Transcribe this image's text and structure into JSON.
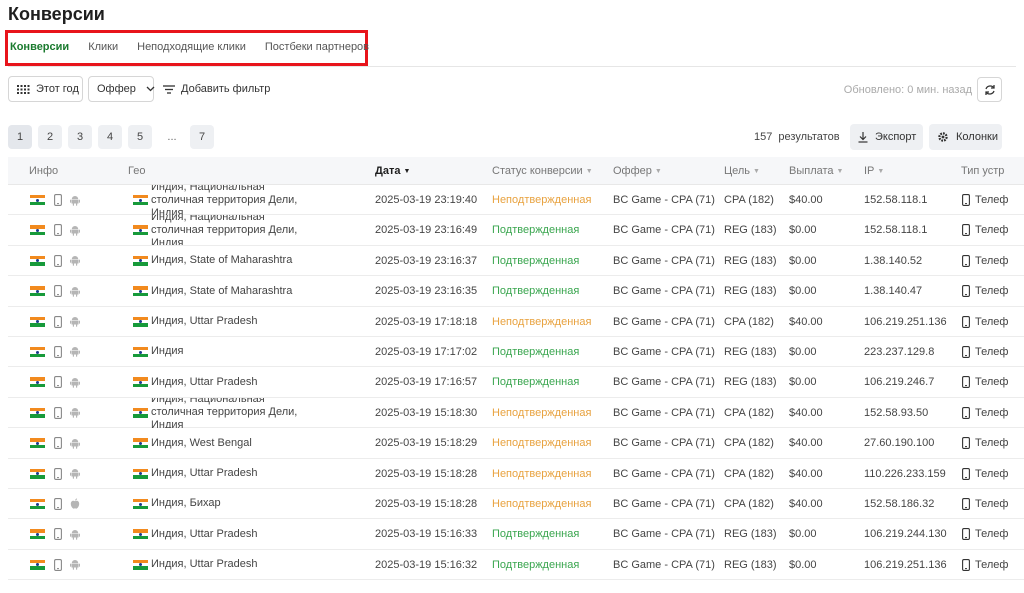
{
  "page": {
    "title": "Конверсии"
  },
  "tabs": [
    {
      "label": "Конверсии",
      "active": true
    },
    {
      "label": "Клики",
      "active": false
    },
    {
      "label": "Неподходящие клики",
      "active": false
    },
    {
      "label": "Постбеки партнеров",
      "active": false
    }
  ],
  "toolbar": {
    "period_label": "Этот год",
    "offer_label": "Оффер",
    "add_filter_label": "Добавить фильтр",
    "updated_text": "Обновлено: 0 мин. назад"
  },
  "pagination": {
    "pages": [
      "1",
      "2",
      "3",
      "4",
      "5"
    ],
    "dots": "...",
    "last_page": "7",
    "current": "1"
  },
  "results": {
    "count": "157",
    "label": "результатов",
    "export_label": "Экспорт",
    "columns_label": "Колонки"
  },
  "table": {
    "headers": {
      "info": "Инфо",
      "geo": "Гео",
      "date": "Дата",
      "status": "Статус конверсии",
      "offer": "Оффер",
      "goal": "Цель",
      "payout": "Выплата",
      "ip": "IP",
      "device": "Тип устр"
    },
    "rows": [
      {
        "geo": "Индия, Национальная столичная территория Дели, Индия",
        "date": "2025-03-19 23:19:40",
        "status": "Неподтвержденная",
        "status_kind": "pending",
        "offer": "BC Game - CPA (71)",
        "goal": "CPA (182)",
        "payout": "$40.00",
        "ip": "152.58.118.1",
        "device": "Телеф",
        "os": "android"
      },
      {
        "geo": "Индия, Национальная столичная территория Дели, Индия",
        "date": "2025-03-19 23:16:49",
        "status": "Подтвержденная",
        "status_kind": "confirmed",
        "offer": "BC Game - CPA (71)",
        "goal": "REG (183)",
        "payout": "$0.00",
        "ip": "152.58.118.1",
        "device": "Телеф",
        "os": "android"
      },
      {
        "geo": "Индия, State of Maharashtra",
        "date": "2025-03-19 23:16:37",
        "status": "Подтвержденная",
        "status_kind": "confirmed",
        "offer": "BC Game - CPA (71)",
        "goal": "REG (183)",
        "payout": "$0.00",
        "ip": "1.38.140.52",
        "device": "Телеф",
        "os": "android"
      },
      {
        "geo": "Индия, State of Maharashtra",
        "date": "2025-03-19 23:16:35",
        "status": "Подтвержденная",
        "status_kind": "confirmed",
        "offer": "BC Game - CPA (71)",
        "goal": "REG (183)",
        "payout": "$0.00",
        "ip": "1.38.140.47",
        "device": "Телеф",
        "os": "android"
      },
      {
        "geo": "Индия, Uttar Pradesh",
        "date": "2025-03-19 17:18:18",
        "status": "Неподтвержденная",
        "status_kind": "pending",
        "offer": "BC Game - CPA (71)",
        "goal": "CPA (182)",
        "payout": "$40.00",
        "ip": "106.219.251.136",
        "device": "Телеф",
        "os": "android"
      },
      {
        "geo": "Индия",
        "date": "2025-03-19 17:17:02",
        "status": "Подтвержденная",
        "status_kind": "confirmed",
        "offer": "BC Game - CPA (71)",
        "goal": "REG (183)",
        "payout": "$0.00",
        "ip": "223.237.129.8",
        "device": "Телеф",
        "os": "android"
      },
      {
        "geo": "Индия, Uttar Pradesh",
        "date": "2025-03-19 17:16:57",
        "status": "Подтвержденная",
        "status_kind": "confirmed",
        "offer": "BC Game - CPA (71)",
        "goal": "REG (183)",
        "payout": "$0.00",
        "ip": "106.219.246.7",
        "device": "Телеф",
        "os": "android"
      },
      {
        "geo": "Индия, Национальная столичная территория Дели, Индия",
        "date": "2025-03-19 15:18:30",
        "status": "Неподтвержденная",
        "status_kind": "pending",
        "offer": "BC Game - CPA (71)",
        "goal": "CPA (182)",
        "payout": "$40.00",
        "ip": "152.58.93.50",
        "device": "Телеф",
        "os": "android"
      },
      {
        "geo": "Индия, West Bengal",
        "date": "2025-03-19 15:18:29",
        "status": "Неподтвержденная",
        "status_kind": "pending",
        "offer": "BC Game - CPA (71)",
        "goal": "CPA (182)",
        "payout": "$40.00",
        "ip": "27.60.190.100",
        "device": "Телеф",
        "os": "android"
      },
      {
        "geo": "Индия, Uttar Pradesh",
        "date": "2025-03-19 15:18:28",
        "status": "Неподтвержденная",
        "status_kind": "pending",
        "offer": "BC Game - CPA (71)",
        "goal": "CPA (182)",
        "payout": "$40.00",
        "ip": "110.226.233.159",
        "device": "Телеф",
        "os": "android"
      },
      {
        "geo": "Индия, Бихар",
        "date": "2025-03-19 15:18:28",
        "status": "Неподтвержденная",
        "status_kind": "pending",
        "offer": "BC Game - CPA (71)",
        "goal": "CPA (182)",
        "payout": "$40.00",
        "ip": "152.58.186.32",
        "device": "Телеф",
        "os": "apple"
      },
      {
        "geo": "Индия, Uttar Pradesh",
        "date": "2025-03-19 15:16:33",
        "status": "Подтвержденная",
        "status_kind": "confirmed",
        "offer": "BC Game - CPA (71)",
        "goal": "REG (183)",
        "payout": "$0.00",
        "ip": "106.219.244.130",
        "device": "Телеф",
        "os": "android"
      },
      {
        "geo": "Индия, Uttar Pradesh",
        "date": "2025-03-19 15:16:32",
        "status": "Подтвержденная",
        "status_kind": "confirmed",
        "offer": "BC Game - CPA (71)",
        "goal": "REG (183)",
        "payout": "$0.00",
        "ip": "106.219.251.136",
        "device": "Телеф",
        "os": "android"
      }
    ]
  },
  "colors": {
    "accent_green": "#1a7a2e",
    "status_pending": "#e8a23f",
    "status_confirmed": "#3aa64f",
    "highlight_red": "#e8141b"
  },
  "icons": {
    "period": "grid-dots-icon",
    "offer": "chevron-down-icon",
    "filter": "filter-lines-icon",
    "refresh": "refresh-icon",
    "export": "download-icon",
    "columns": "gear-icon",
    "device": "phone-icon"
  }
}
